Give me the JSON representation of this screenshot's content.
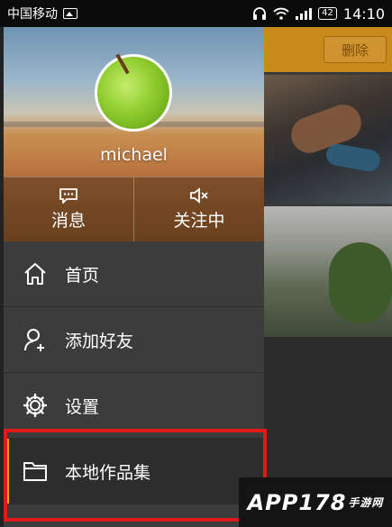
{
  "status_bar": {
    "carrier": "中国移动",
    "battery": "42",
    "time": "14:10"
  },
  "main": {
    "delete_label": "删除"
  },
  "profile": {
    "username": "michael",
    "actions": [
      {
        "label": "消息",
        "icon": "message-icon"
      },
      {
        "label": "关注中",
        "icon": "speaker-muted-icon"
      }
    ]
  },
  "menu": {
    "items": [
      {
        "label": "首页",
        "icon": "home-icon"
      },
      {
        "label": "添加好友",
        "icon": "add-friend-icon"
      },
      {
        "label": "设置",
        "icon": "gear-icon"
      },
      {
        "label": "本地作品集",
        "icon": "folder-icon",
        "active": true
      }
    ]
  },
  "colors": {
    "accent": "#f5a31a",
    "highlight": "#e01818",
    "drawer_bg": "#3c3c3c"
  },
  "watermark": {
    "text": "APP178",
    "sub": "手游网"
  }
}
